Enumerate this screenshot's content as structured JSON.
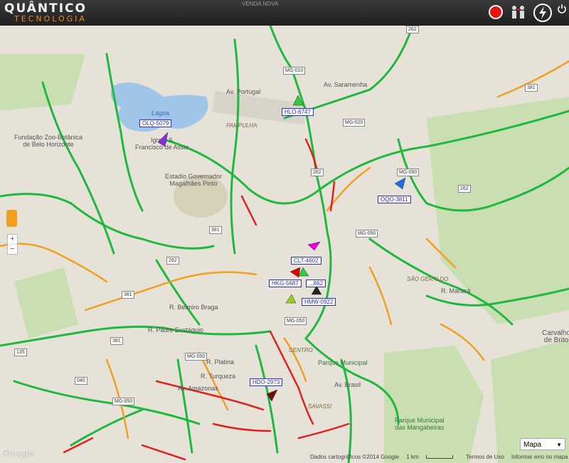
{
  "header": {
    "brand_line1": "QUÂNTICO",
    "brand_line2": "TECNOLOGIA",
    "top_label": "VENDA NOVA",
    "icons": [
      "record-icon",
      "operators-icon",
      "flash-icon",
      "power-icon"
    ]
  },
  "map": {
    "labels": {
      "lagoa": "Lagoa",
      "pampulha": "PAMPULHA",
      "zoo1": "Fundação Zoo-Botânica",
      "zoo2": "de Belo Horizonte",
      "igreja1": "Igreja S",
      "igreja2": "Francisco de Assis",
      "estadio1": "Estadio Governador",
      "estadio2": "Magalhães Pinto",
      "saogeraldo": "SÃO GERALDO",
      "carvalho1": "Carvalho",
      "carvalho2": "de Brito",
      "parque": "Parque Municipal",
      "mang1": "Parque Municipal",
      "mang2": "das Mangabeiras",
      "savassi": "SAVASSI",
      "centro": "CENTRO",
      "belmiro": "R. Belmiro Braga",
      "padre": "R. Padre Eustáquio",
      "platina": "R. Platina",
      "turqueza": "R. Turqueza",
      "amazonas": "Av. Amazonas",
      "brasil": "Av. Brasil",
      "maracá": "R. Maracá",
      "portugal": "Av. Portugal",
      "saramenha": "Av. Saramenha"
    },
    "shields": [
      "MG-010",
      "MG-020",
      "MG-050",
      "MG-050",
      "MG-050",
      "MG-050",
      "MG-050",
      "381",
      "381",
      "381",
      "262",
      "262",
      "262",
      "262",
      "135",
      "040",
      "381"
    ],
    "vehicles": [
      {
        "plate": "OLQ-5079",
        "color": "#8a2be2"
      },
      {
        "plate": "HLO-6747",
        "color": "#2ecc40"
      },
      {
        "plate": "OQO-3811",
        "color": "#1e6fd9"
      },
      {
        "plate": "CLT-4602",
        "color": "#e600e6"
      },
      {
        "plate": "HKG-5687",
        "color": "#e00000"
      },
      {
        "plate": "HMW-0922",
        "color": "#222222"
      },
      {
        "plate": "HDO-2973",
        "color": "#6b1010"
      },
      {
        "plate": "...862",
        "color": "#90d020"
      }
    ],
    "colors": {
      "fast": "#1fb83f",
      "medium": "#f0a020",
      "slow": "#e02020",
      "water": "#9fc5e8",
      "park": "#c8dfb0"
    }
  },
  "controls": {
    "map_type": "Mapa",
    "zoom_in": "+",
    "zoom_out": "−"
  },
  "footer": {
    "data": "Dados cartográficos ©2014 Google",
    "scale": "1 km",
    "terms": "Termos de Uso",
    "report": "Informar erro no mapa",
    "google": "Google"
  }
}
